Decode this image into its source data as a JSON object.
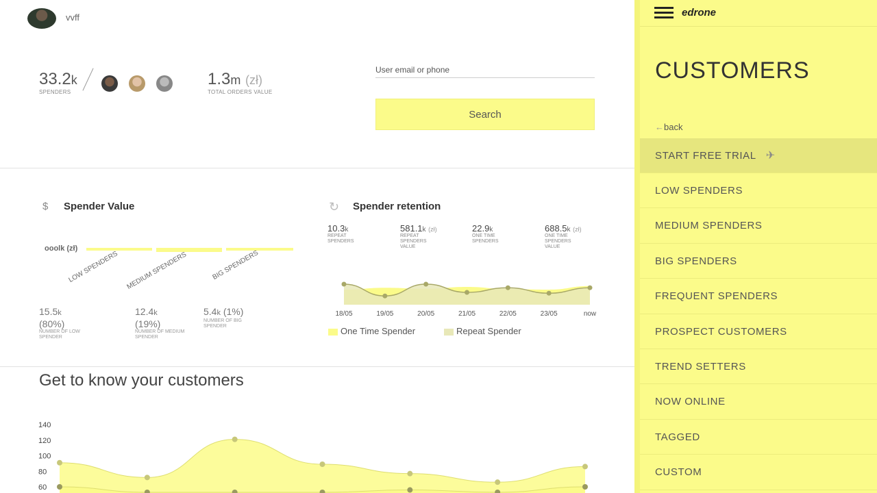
{
  "header": {
    "username": "vvff"
  },
  "stats": {
    "spenders_value": "33.2",
    "spenders_unit": "k",
    "spenders_caption": "SPENDERS",
    "orders_value": "1.3",
    "orders_unit": "m",
    "orders_currency": "(zł)",
    "orders_caption": "TOTAL ORDERS VALUE"
  },
  "search": {
    "label": "User email or phone",
    "button": "Search"
  },
  "spender_value": {
    "title": "Spender Value",
    "icon": "dollar-icon",
    "axis_overlap_text": "ooolk (zł)",
    "bar_labels": [
      "LOW SPENDERS",
      "MEDIUM SPENDERS",
      "BIG SPENDERS"
    ],
    "groups": [
      {
        "value": "15.5",
        "unit": "k",
        "percent": "(80%)",
        "caption": "NUMBER OF LOW SPENDER"
      },
      {
        "value": "12.4",
        "unit": "k",
        "percent": "(19%)",
        "caption": "NUMBER OF MEDIUM SPENDER"
      },
      {
        "value": "5.4",
        "unit": "k",
        "percent": "(1%)",
        "caption": "NUMBER OF BIG SPENDER"
      }
    ]
  },
  "retention": {
    "title": "Spender retention",
    "icon": "refresh-icon",
    "stats": [
      {
        "value": "10.3",
        "unit": "k",
        "currency": "",
        "caption": "REPEAT SPENDERS"
      },
      {
        "value": "581.1",
        "unit": "k",
        "currency": "(zł)",
        "caption": "REPEAT SPENDERS VALUE"
      },
      {
        "value": "22.9",
        "unit": "k",
        "currency": "",
        "caption": "ONE TIME SPENDERS"
      },
      {
        "value": "688.5",
        "unit": "k",
        "currency": "(zł)",
        "caption": "ONE TIME SPENDERS VALUE"
      }
    ],
    "legend": [
      {
        "label": "One Time Spender",
        "color": "#fbfb8a"
      },
      {
        "label": "Repeat Spender",
        "color": "#e8e8b8"
      }
    ]
  },
  "customers_section": {
    "title": "Get to know your customers"
  },
  "chart_data": [
    {
      "type": "area",
      "title": "Spender retention",
      "x": [
        "18/05",
        "19/05",
        "20/05",
        "21/05",
        "22/05",
        "23/05",
        "now"
      ],
      "series": [
        {
          "name": "One Time Spender",
          "values": [
            0.55,
            0.62,
            0.58,
            0.65,
            0.57,
            0.55,
            0.68
          ]
        },
        {
          "name": "Repeat Spender",
          "values": [
            0.75,
            0.32,
            0.75,
            0.45,
            0.62,
            0.42,
            0.62
          ]
        }
      ],
      "ylim": [
        0,
        1
      ],
      "color": [
        "#fbfb8a",
        "#e8e8b8"
      ],
      "marker_color": "#a8a868"
    },
    {
      "type": "area",
      "title": "Get to know your customers",
      "yticks": [
        140,
        120,
        100,
        80,
        60
      ],
      "ylim": [
        55,
        140
      ],
      "series": [
        {
          "values": [
            91,
            72,
            121,
            89,
            77,
            66,
            86
          ]
        },
        {
          "values": [
            60,
            53,
            53,
            53,
            56,
            53,
            60
          ]
        }
      ],
      "color": "#fbfb8a",
      "marker_color": "#c7c77a"
    }
  ],
  "sidebar": {
    "brand": "edrone",
    "title": "CUSTOMERS",
    "back": "back",
    "items": [
      {
        "label": "START FREE TRIAL",
        "active": true
      },
      {
        "label": "LOW SPENDERS"
      },
      {
        "label": "MEDIUM SPENDERS"
      },
      {
        "label": "BIG SPENDERS"
      },
      {
        "label": "FREQUENT SPENDERS"
      },
      {
        "label": "PROSPECT CUSTOMERS"
      },
      {
        "label": "TREND SETTERS"
      },
      {
        "label": "NOW ONLINE"
      },
      {
        "label": "TAGGED"
      },
      {
        "label": "CUSTOM"
      }
    ]
  }
}
